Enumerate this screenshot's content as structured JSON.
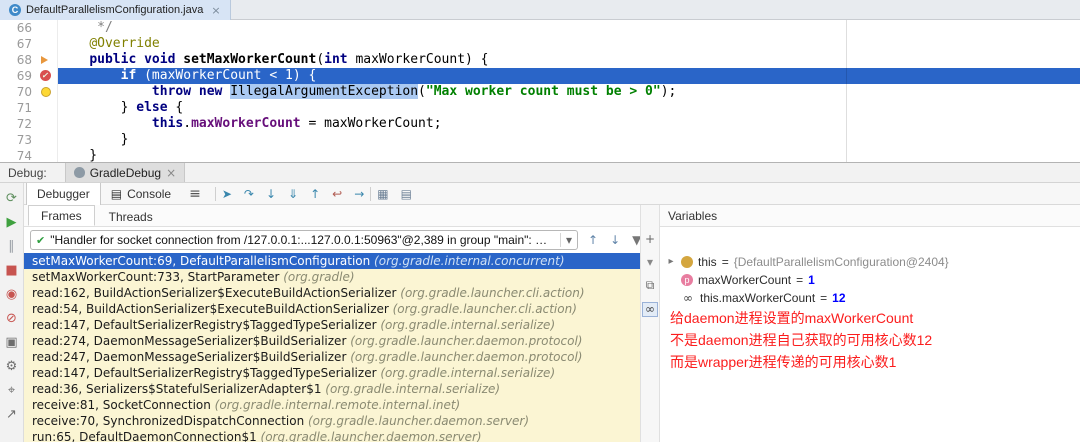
{
  "palette": {
    "execution_line_blue": "#2a65c8",
    "selected_frame_blue": "#2a65c8",
    "frames_background_yellow": "#fbf5d3",
    "breakpoint_red": "#d9504e",
    "annotation_red": "#fb1d1d",
    "keyword_blue": "#000080",
    "string_green": "#008000",
    "field_purple": "#660e7a",
    "word_selection_blue": "#aac9f2"
  },
  "editor": {
    "tab": {
      "icon_letter": "C",
      "title": "DefaultParallelismConfiguration.java",
      "close_glyph": "×"
    },
    "lines": [
      {
        "num": "66",
        "tokens": [
          [
            "     */",
            "comment"
          ]
        ]
      },
      {
        "num": "67",
        "tokens": [
          [
            "    ",
            "plain"
          ],
          [
            "@Override",
            "ann"
          ]
        ]
      },
      {
        "num": "68",
        "mark": "run",
        "tokens": [
          [
            "    ",
            "plain"
          ],
          [
            "public",
            "kw"
          ],
          [
            " ",
            "plain"
          ],
          [
            "void",
            "kw"
          ],
          [
            " ",
            "plain"
          ],
          [
            "setMaxWorkerCount",
            "method"
          ],
          [
            "(",
            "plain"
          ],
          [
            "int",
            "kw"
          ],
          [
            " maxWorkerCount) {",
            "plain"
          ]
        ]
      },
      {
        "num": "69",
        "current": true,
        "mark": "breakpoint",
        "tokens": [
          [
            "        ",
            "plain"
          ],
          [
            "if",
            "kw"
          ],
          [
            " (maxWorkerCount < ",
            "plain"
          ],
          [
            "1",
            "numlit"
          ],
          [
            ") {",
            "plain"
          ]
        ]
      },
      {
        "num": "70",
        "mark": "bulb",
        "tokens": [
          [
            "            ",
            "plain"
          ],
          [
            "throw",
            "kw"
          ],
          [
            " ",
            "plain"
          ],
          [
            "new",
            "kw"
          ],
          [
            " ",
            "plain"
          ],
          [
            "IllegalArgumentException",
            "sel"
          ],
          [
            "(",
            "plain"
          ],
          [
            "\"Max worker count must be > 0\"",
            "str"
          ],
          [
            ");",
            "plain"
          ]
        ]
      },
      {
        "num": "71",
        "tokens": [
          [
            "        } ",
            "plain"
          ],
          [
            "else",
            "kw"
          ],
          [
            " {",
            "plain"
          ]
        ]
      },
      {
        "num": "72",
        "tokens": [
          [
            "            ",
            "plain"
          ],
          [
            "this",
            "kw"
          ],
          [
            ".",
            "plain"
          ],
          [
            "maxWorkerCount",
            "field"
          ],
          [
            " = maxWorkerCount;",
            "plain"
          ]
        ]
      },
      {
        "num": "73",
        "tokens": [
          [
            "        }",
            "plain"
          ]
        ]
      },
      {
        "num": "74",
        "tokens": [
          [
            "    }",
            "plain"
          ]
        ]
      }
    ]
  },
  "debug": {
    "label": "Debug:",
    "session_tab": {
      "title": "GradleDebug",
      "close_glyph": "×"
    },
    "tabs": [
      {
        "label": "Debugger"
      },
      {
        "label": "Console"
      }
    ],
    "icons": {
      "hamburger": "≡",
      "console_glyph": "▤",
      "check": "✔",
      "chevron_down": "▾",
      "expand": "▸"
    },
    "left_toolbar": [
      {
        "name": "rerun-icon",
        "glyph": "⟳",
        "color": "#5f8f5f"
      },
      {
        "name": "resume-icon",
        "glyph": "▶",
        "color": "#3fa13f"
      },
      {
        "name": "pause-icon",
        "glyph": "∥",
        "color": "#9aa0a6"
      },
      {
        "name": "stop-icon",
        "glyph": "■",
        "color": "#c75450"
      },
      {
        "name": "view-breakpoints-icon",
        "glyph": "◉",
        "color": "#c75450"
      },
      {
        "name": "mute-breakpoints-icon",
        "glyph": "⊘",
        "color": "#c75450"
      },
      {
        "name": "thread-dump-icon",
        "glyph": "▣",
        "color": "#6e6e6e"
      },
      {
        "name": "settings-icon",
        "glyph": "⚙",
        "color": "#6e6e6e"
      },
      {
        "name": "pin-icon",
        "glyph": "⌖",
        "color": "#6e6e6e"
      },
      {
        "name": "restore-layout-icon",
        "glyph": "↗",
        "color": "#6e6e6e"
      }
    ],
    "step_icons": [
      {
        "name": "show-execution-point-icon",
        "glyph": "➤",
        "color": "#3a87ad"
      },
      {
        "name": "step-over-icon",
        "glyph": "↷",
        "color": "#3a87ad"
      },
      {
        "name": "step-into-icon",
        "glyph": "↓",
        "color": "#3a87ad"
      },
      {
        "name": "force-step-into-icon",
        "glyph": "⇓",
        "color": "#3a87ad"
      },
      {
        "name": "step-out-icon",
        "glyph": "↑",
        "color": "#3a87ad"
      },
      {
        "name": "drop-frame-icon",
        "glyph": "↩",
        "color": "#b05a50"
      },
      {
        "name": "run-to-cursor-icon",
        "glyph": "→",
        "color": "#3a87ad"
      }
    ],
    "view_icons": [
      {
        "name": "grid-icon",
        "glyph": "▦",
        "color": "#6b7f95"
      },
      {
        "name": "layout-icon",
        "glyph": "▤",
        "color": "#6b7f95"
      }
    ],
    "frames_tabs": [
      "Frames",
      "Threads"
    ],
    "thread_selector": {
      "text": "\"Handler for socket connection from /127.0.0.1:...127.0.0.1:50963\"@2,389 in group \"main\": RUNNING"
    },
    "frame_nav_icons": [
      {
        "name": "frame-up-icon",
        "glyph": "↑",
        "color": "#5f83a8"
      },
      {
        "name": "frame-down-icon",
        "glyph": "↓",
        "color": "#5f83a8"
      },
      {
        "name": "filter-frames-icon",
        "glyph": "▼",
        "color": "#777777"
      }
    ],
    "side_toolbar": [
      {
        "name": "add-watch-icon",
        "glyph": "+",
        "color": "#666666"
      },
      {
        "name": "collapse-icon",
        "glyph": "▾",
        "color": "#888888"
      },
      {
        "name": "copy-icon",
        "glyph": "⧉",
        "color": "#666666"
      },
      {
        "name": "show-watches-icon",
        "glyph": "∞",
        "color": "#444444",
        "boxed": true
      }
    ],
    "variables_title": "Variables",
    "frames": [
      {
        "loc": "setMaxWorkerCount:69, DefaultParallelismConfiguration",
        "pkg": "(org.gradle.internal.concurrent)",
        "selected": true
      },
      {
        "loc": "setMaxWorkerCount:733, StartParameter",
        "pkg": "(org.gradle)"
      },
      {
        "loc": "read:162, BuildActionSerializer$ExecuteBuildActionSerializer",
        "pkg": "(org.gradle.launcher.cli.action)"
      },
      {
        "loc": "read:54, BuildActionSerializer$ExecuteBuildActionSerializer",
        "pkg": "(org.gradle.launcher.cli.action)"
      },
      {
        "loc": "read:147, DefaultSerializerRegistry$TaggedTypeSerializer",
        "pkg": "(org.gradle.internal.serialize)"
      },
      {
        "loc": "read:274, DaemonMessageSerializer$BuildSerializer",
        "pkg": "(org.gradle.launcher.daemon.protocol)"
      },
      {
        "loc": "read:247, DaemonMessageSerializer$BuildSerializer",
        "pkg": "(org.gradle.launcher.daemon.protocol)"
      },
      {
        "loc": "read:147, DefaultSerializerRegistry$TaggedTypeSerializer",
        "pkg": "(org.gradle.internal.serialize)"
      },
      {
        "loc": "read:36, Serializers$StatefulSerializerAdapter$1",
        "pkg": "(org.gradle.internal.serialize)"
      },
      {
        "loc": "receive:81, SocketConnection",
        "pkg": "(org.gradle.internal.remote.internal.inet)"
      },
      {
        "loc": "receive:70, SynchronizedDispatchConnection",
        "pkg": "(org.gradle.launcher.daemon.server)"
      },
      {
        "loc": "run:65, DefaultDaemonConnection$1",
        "pkg": "(org.gradle.launcher.daemon.server)"
      }
    ],
    "variables": [
      {
        "kind": "this",
        "glyph": "",
        "expand": true,
        "name": "this",
        "value": "{DefaultParallelismConfiguration@2404}",
        "numeric": false
      },
      {
        "kind": "param",
        "glyph": "p",
        "name": "maxWorkerCount",
        "value": "1",
        "numeric": true
      },
      {
        "kind": "watch",
        "glyph": "∞",
        "name": "this.maxWorkerCount",
        "value": "12",
        "numeric": true
      }
    ],
    "notes": [
      "给daemon进程设置的maxWorkerCount",
      "不是daemon进程自己获取的可用核心数12",
      "而是wrapper进程传递的可用核心数1"
    ]
  }
}
